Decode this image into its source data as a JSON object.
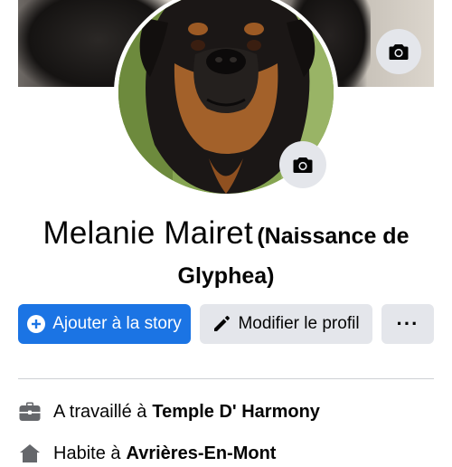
{
  "profile": {
    "name": "Melanie Mairet",
    "alternate_name": "(Naissance de Glyphea)"
  },
  "actions": {
    "add_story_label": "Ajouter à la story",
    "edit_profile_label": "Modifier le profil",
    "more_label": "···"
  },
  "details": [
    {
      "prefix": "A travaillé à",
      "value": "Temple D' Harmony"
    },
    {
      "prefix": "Habite à",
      "value": "Avrières-En-Mont"
    }
  ],
  "colors": {
    "primary": "#1b74e4",
    "secondary_button": "#e4e6eb",
    "text": "#050505",
    "divider": "#ced0d4"
  },
  "icons": {
    "cover_camera": "camera-icon",
    "avatar_camera": "camera-icon",
    "add_story": "plus-circle-icon",
    "edit_profile": "pencil-icon",
    "more": "ellipsis-icon",
    "work": "briefcase-icon",
    "home": "home-icon"
  }
}
